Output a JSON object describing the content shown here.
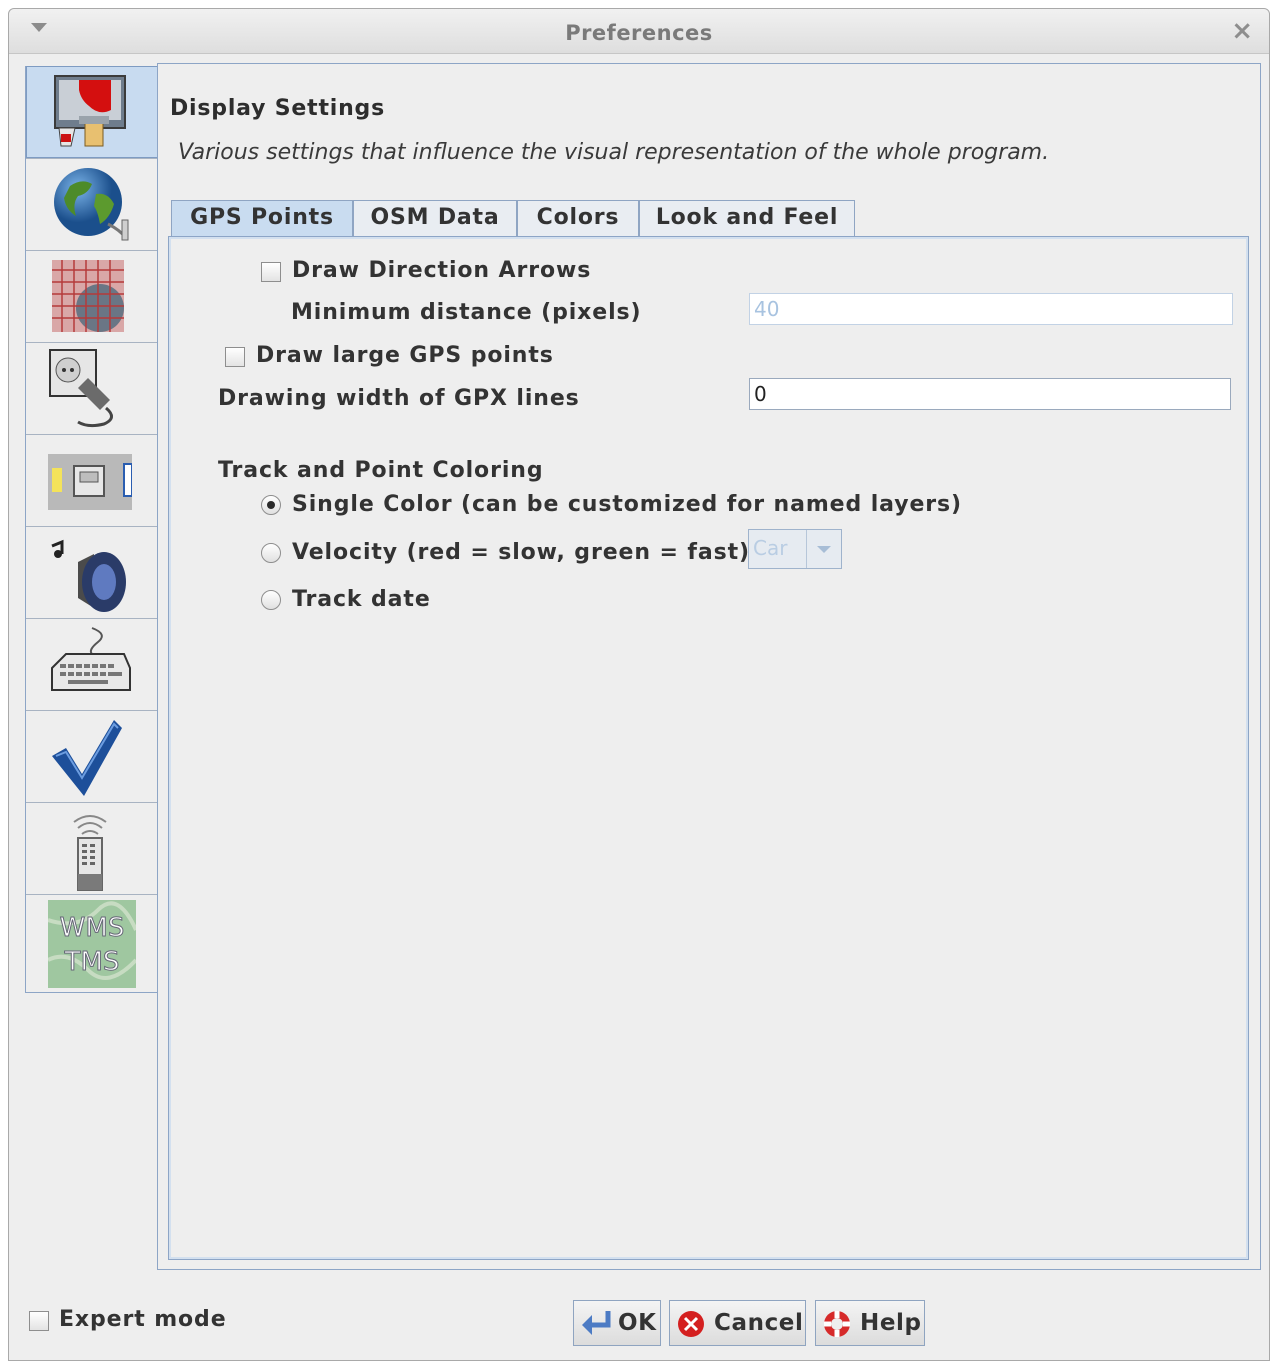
{
  "window": {
    "title": "Preferences"
  },
  "sidebar": {
    "items": [
      {
        "name": "display-settings",
        "icon": "paint-brush-icon",
        "active": true
      },
      {
        "name": "connection-settings",
        "icon": "globe-icon",
        "active": false
      },
      {
        "name": "map-projection",
        "icon": "grid-map-icon",
        "active": false
      },
      {
        "name": "plugins",
        "icon": "plug-icon",
        "active": false
      },
      {
        "name": "presets",
        "icon": "presets-icon",
        "active": false
      },
      {
        "name": "audio",
        "icon": "speaker-icon",
        "active": false
      },
      {
        "name": "shortcuts",
        "icon": "keyboard-icon",
        "active": false
      },
      {
        "name": "validator",
        "icon": "checkmark-icon",
        "active": false
      },
      {
        "name": "remote-control",
        "icon": "remote-control-icon",
        "active": false
      },
      {
        "name": "imagery",
        "icon": "wms-tms-icon",
        "label": "WMS\nTMS",
        "active": false
      }
    ]
  },
  "header": {
    "title": "Display Settings",
    "description": "Various settings that influence the visual representation of the whole program."
  },
  "tabs": [
    {
      "label": "GPS Points",
      "active": true
    },
    {
      "label": "OSM Data",
      "active": false
    },
    {
      "label": "Colors",
      "active": false
    },
    {
      "label": "Look and Feel",
      "active": false
    }
  ],
  "gps": {
    "draw_arrows": {
      "label": "Draw Direction Arrows",
      "checked": false
    },
    "min_distance": {
      "label": "Minimum distance (pixels)",
      "value": "40",
      "disabled": true
    },
    "large_points": {
      "label": "Draw large GPS points",
      "checked": false
    },
    "line_width": {
      "label": "Drawing width of GPX lines",
      "value": "0"
    },
    "coloring": {
      "title": "Track and Point Coloring",
      "single": {
        "label": "Single Color (can be customized for named layers)",
        "selected": true
      },
      "velocity": {
        "label": "Velocity (red = slow, green = fast)",
        "selected": false,
        "combo_value": "Car"
      },
      "date": {
        "label": "Track date",
        "selected": false
      }
    }
  },
  "footer": {
    "expert_mode": {
      "label": "Expert mode",
      "checked": false
    },
    "ok_label": "OK",
    "cancel_label": "Cancel",
    "help_label": "Help"
  }
}
